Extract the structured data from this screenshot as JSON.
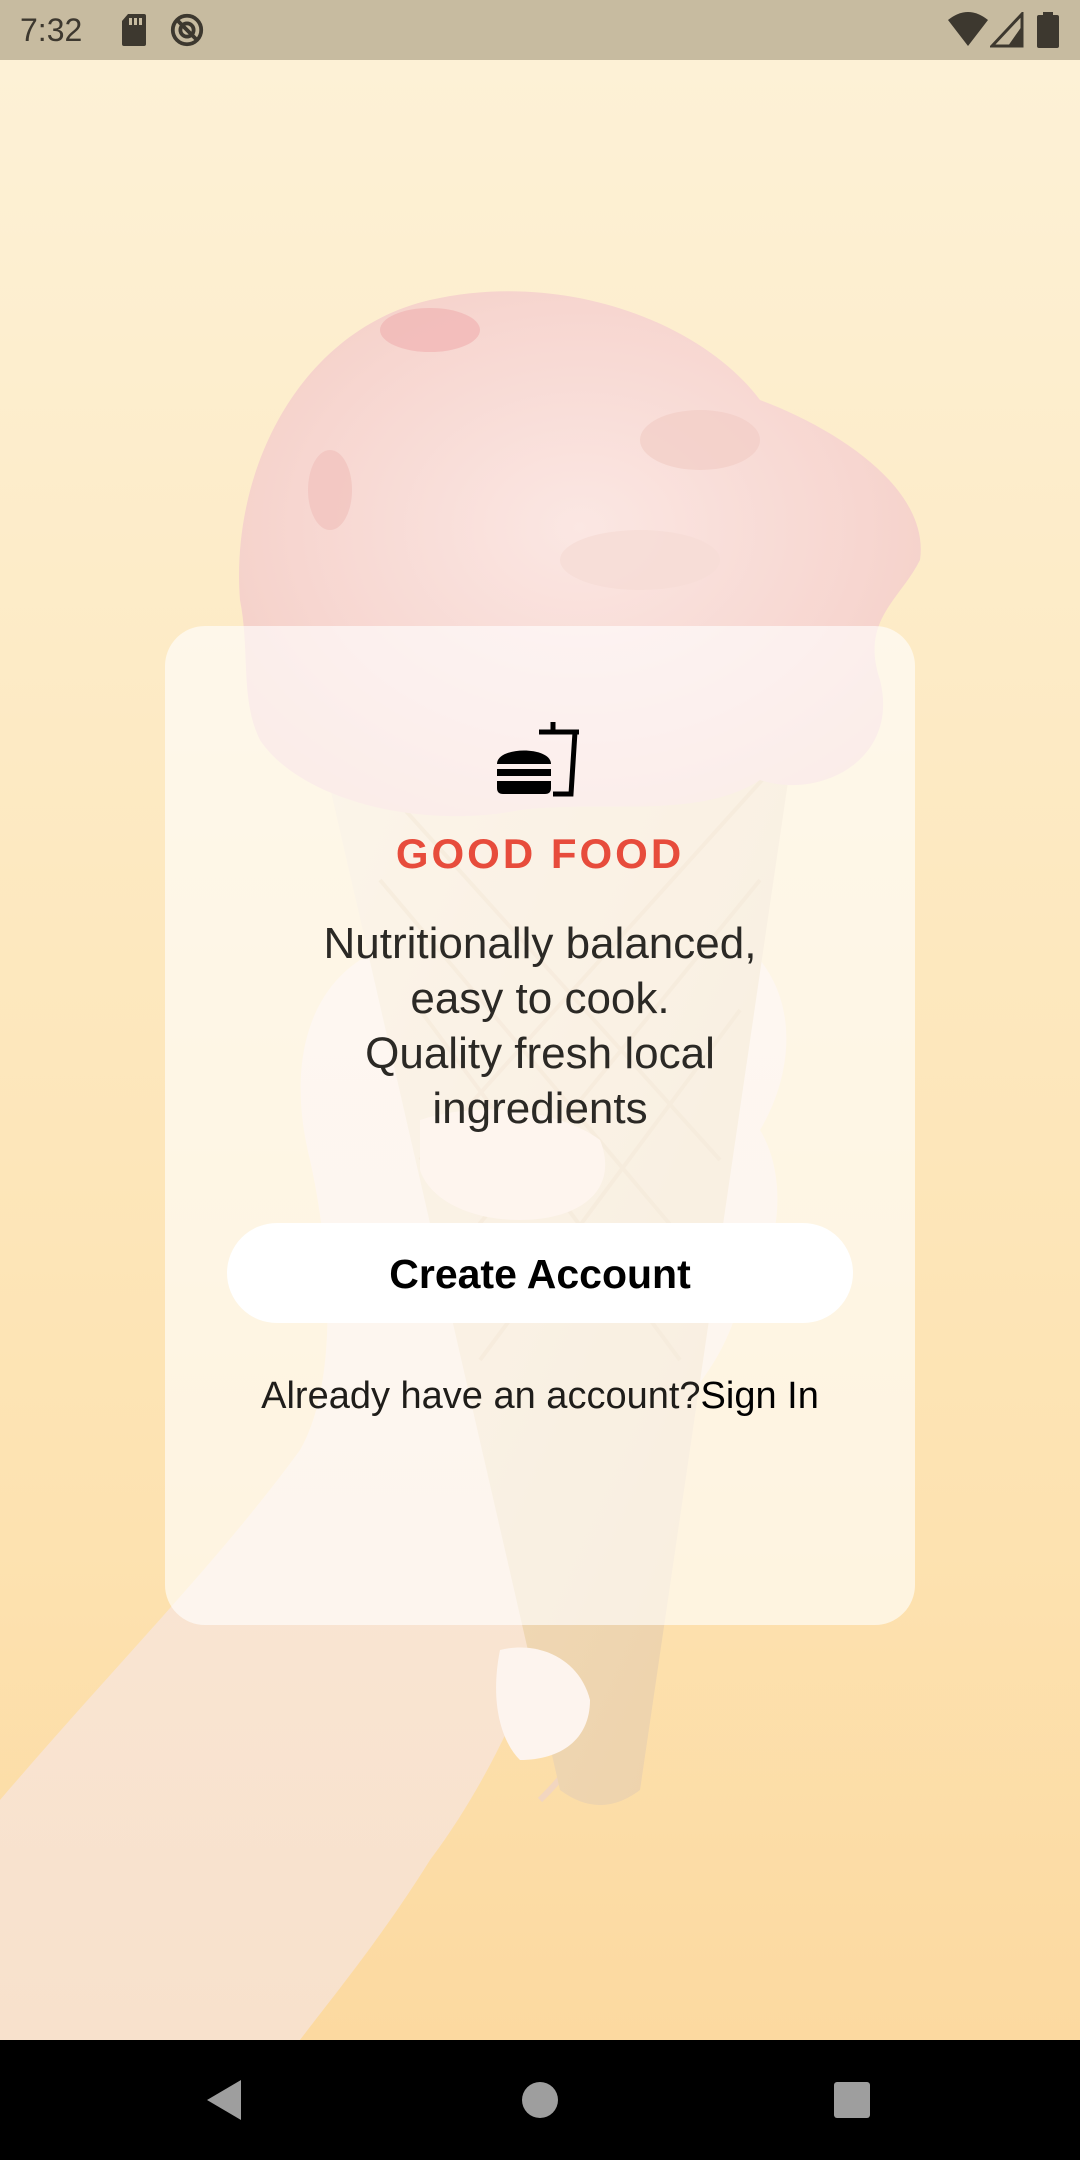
{
  "status_bar": {
    "time": "7:32",
    "left_icons": [
      "sd-card-icon",
      "do-not-disturb-icon"
    ],
    "right_icons": [
      "wifi-icon",
      "cell-signal-icon",
      "battery-icon"
    ]
  },
  "card": {
    "logo_icon": "fastfood-icon",
    "brand": "GOOD FOOD",
    "tagline_lines": [
      "Nutritionally balanced,",
      "easy to cook.",
      "Quality fresh local",
      "ingredients"
    ],
    "create_account_label": "Create Account",
    "signin_prompt": "Already have an account?",
    "signin_link": "Sign In"
  },
  "nav_bar": {
    "back": "back-icon",
    "home": "home-icon",
    "recents": "recents-icon"
  },
  "colors": {
    "brand": "#e74c3c",
    "status_bar": "#c7bba0",
    "card_background": "#ffffff",
    "nav_bar": "#000000"
  }
}
